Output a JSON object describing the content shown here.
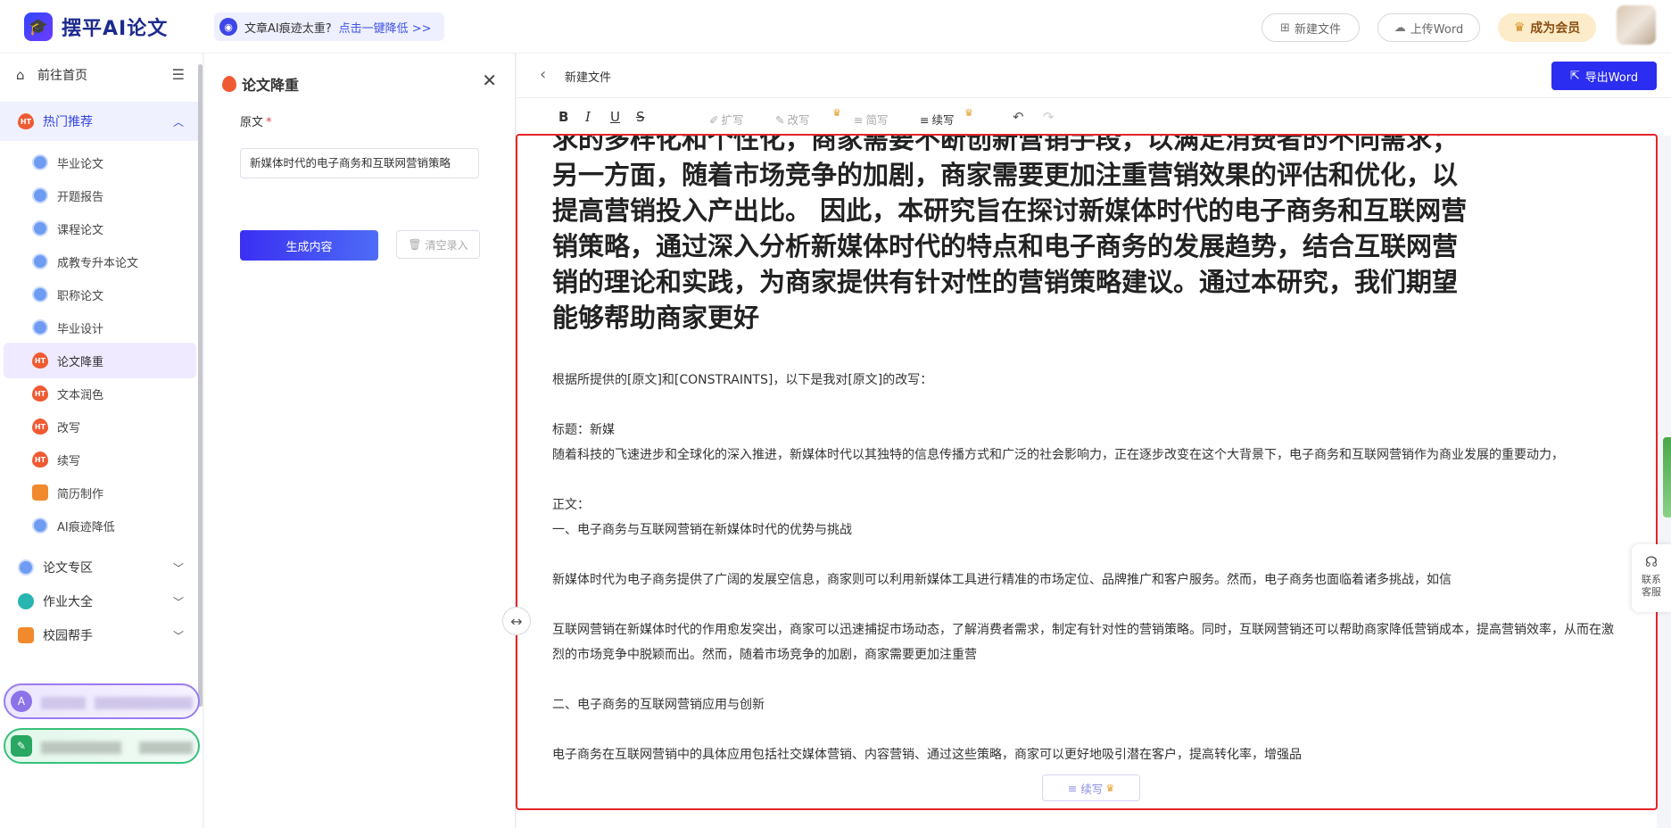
{
  "topbar": {
    "brand": "摆平AI论文",
    "promo_text": "文章AI痕迹太重?",
    "promo_link": "点击一键降低 >>",
    "new_file": "新建文件",
    "upload_word": "上传Word",
    "vip": "成为会员"
  },
  "sidebar": {
    "home": "前往首页",
    "hot_group": "热门推荐",
    "items": [
      {
        "label": "毕业论文",
        "icon": "blue"
      },
      {
        "label": "开题报告",
        "icon": "blue"
      },
      {
        "label": "课程论文",
        "icon": "blue"
      },
      {
        "label": "成教专升本论文",
        "icon": "blue"
      },
      {
        "label": "职称论文",
        "icon": "blue"
      },
      {
        "label": "毕业设计",
        "icon": "blue"
      },
      {
        "label": "论文降重",
        "icon": "fire"
      },
      {
        "label": "文本润色",
        "icon": "fire"
      },
      {
        "label": "改写",
        "icon": "fire"
      },
      {
        "label": "续写",
        "icon": "fire"
      },
      {
        "label": "简历制作",
        "icon": "orange"
      },
      {
        "label": "AI痕迹降低",
        "icon": "blue"
      }
    ],
    "groups": [
      {
        "label": "论文专区"
      },
      {
        "label": "作业大全"
      },
      {
        "label": "校园帮手"
      }
    ],
    "account_a_initial": "A"
  },
  "panel": {
    "title": "论文降重",
    "field_label": "原文",
    "field_value": "新媒体时代的电子商务和互联网营销策略",
    "generate": "生成内容",
    "clear": "清空录入"
  },
  "editor": {
    "file_name": "新建文件",
    "export": "导出Word",
    "toolbar": {
      "bold": "B",
      "italic": "I",
      "underline": "U",
      "strike": "S",
      "expand": "扩写",
      "rewrite": "改写",
      "shorten": "简写",
      "continue": "续写"
    },
    "big_lines": [
      "求的多样化和个性化，商家需要不断创新营销手段，以满足消费者的不同需求；",
      "另一方面，随着市场竞争的加剧，商家需要更加注重营销效果的评估和优化，以",
      "提高营销投入产出比。 因此，本研究旨在探讨新媒体时代的电子商务和互联网营",
      "销策略，通过深入分析新媒体时代的特点和电子商务的发展趋势，结合互联网营",
      "销的理论和实践，为商家提供有针对性的营销策略建议。通过本研究，我们期望",
      "能够帮助商家更好"
    ],
    "p_intro": "根据所提供的[原文]和[CONSTRAINTS]，以下是我对[原文]的改写：",
    "p_title": "标题：新媒",
    "p_lead": "随着科技的飞速进步和全球化的深入推进，新媒体时代以其独特的信息传播方式和广泛的社会影响力，正在逐步改变在这个大背景下，电子商务和互联网营销作为商业发展的重要动力，",
    "p_body_label": "正文：",
    "p_h1": "一、电子商务与互联网营销在新媒体时代的优势与挑战",
    "p_1": "新媒体时代为电子商务提供了广阔的发展空信息，商家则可以利用新媒体工具进行精准的市场定位、品牌推广和客户服务。然而，电子商务也面临着诸多挑战，如信",
    "p_2": "互联网营销在新媒体时代的作用愈发突出，商家可以迅速捕捉市场动态，了解消费者需求，制定有针对性的营销策略。同时，互联网营销还可以帮助商家降低营销成本，提高营销效率，从而在激烈的市场竞争中脱颖而出。然而，随着市场竞争的加剧，商家需要更加注重营",
    "p_h2": "二、电子商务的互联网营销应用与创新",
    "p_3": "电子商务在互联网营销中的具体应用包括社交媒体营销、内容营销、通过这些策略，商家可以更好地吸引潜在客户，提高转化率，增强品",
    "float_continue": "续写",
    "support": "联系客服"
  },
  "colors": {
    "accent": "#2b2df0",
    "highlight_border": "#e5252a",
    "hot_bg": "#f0f1ff",
    "vip_bg": "#fdecc9"
  }
}
